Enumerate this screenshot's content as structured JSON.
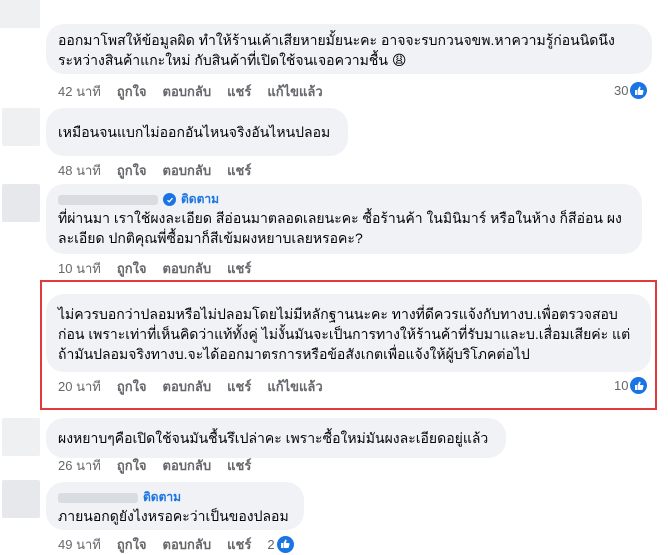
{
  "comments": [
    {
      "text": "ออกมาโพสให้ข้อมูลผิด ทำให้ร้านเค้าเสียหายมั้ยนะคะ อาจจะรบกวนจขพ.หาความรู้ก่อนนิดนึง\nระหว่างสินค้าแกะใหม่ กับสินค้าที่เปิดใช้จนเจอความชื้น 😩",
      "time": "42 นาที",
      "like": "ถูกใจ",
      "reply": "ตอบกลับ",
      "share": "แชร์",
      "edit": "แก้ไขแล้ว",
      "reactions": "30"
    },
    {
      "text": "เหมือนจนแบกไม่ออกอันไหนจริงอันไหนปลอม",
      "time": "48 นาที",
      "like": "ถูกใจ",
      "reply": "ตอบกลับ",
      "share": "แชร์"
    },
    {
      "follow": "ติดตาม",
      "text": "ที่ผ่านมา เราใช้ผงละเอียด สีอ่อนมาตลอดเลยนะคะ ซื้อร้านค้า ในมินิมาร์ หรือในห้าง ก็สีอ่อน ผง\nละเอียด ปกติคุณพี่ซื้อมาก็สีเข้มผงหยาบเลยหรอคะ?",
      "time": "10 นาที",
      "like": "ถูกใจ",
      "reply": "ตอบกลับ",
      "share": "แชร์"
    },
    {
      "text": "ไม่ควรบอกว่าปลอมหรือไม่ปลอมโดยไม่มีหลักฐานนะคะ ทางที่ดีควรแจ้งกับทางบ.เพื่อตรวจสอบ\nก่อน เพราะเท่าที่เห็นคิดว่าแท้ทั้งคู่ ไม่งั้นมันจะเป็นการทางให้ร้านค้าที่รับมาและบ.เสื่อมเสียค่ะ แต่\nถ้ามันปลอมจริงทางบ.จะได้ออกมาตรการหรือข้อสังเกตเพื่อแจ้งให้ผู้บริโภคต่อไป",
      "time": "20 นาที",
      "like": "ถูกใจ",
      "reply": "ตอบกลับ",
      "share": "แชร์",
      "edit": "แก้ไขแล้ว",
      "reactions": "10"
    },
    {
      "text": "ผงหยาบๆคือเปิดใช้จนมันชื้นรึเปล่าคะ เพราะซื้อใหม่มันผงละเอียดอยู่แล้ว",
      "time": "26 นาที",
      "like": "ถูกใจ",
      "reply": "ตอบกลับ",
      "share": "แชร์"
    },
    {
      "follow": "ติดตาม",
      "text": "ภายนอกดูยังไงหรอคะว่าเป็นของปลอม",
      "time": "49 นาที",
      "like": "ถูกใจ",
      "reply": "ตอบกลับ",
      "share": "แชร์",
      "reactions": "2"
    }
  ],
  "colors": {
    "highlight": "#e03a3a",
    "link": "#1b74e4",
    "bubble": "#f0f2f5",
    "meta": "#65676b"
  },
  "icons": {
    "like": "thumbs-up-icon",
    "verified": "verified-check-icon"
  }
}
